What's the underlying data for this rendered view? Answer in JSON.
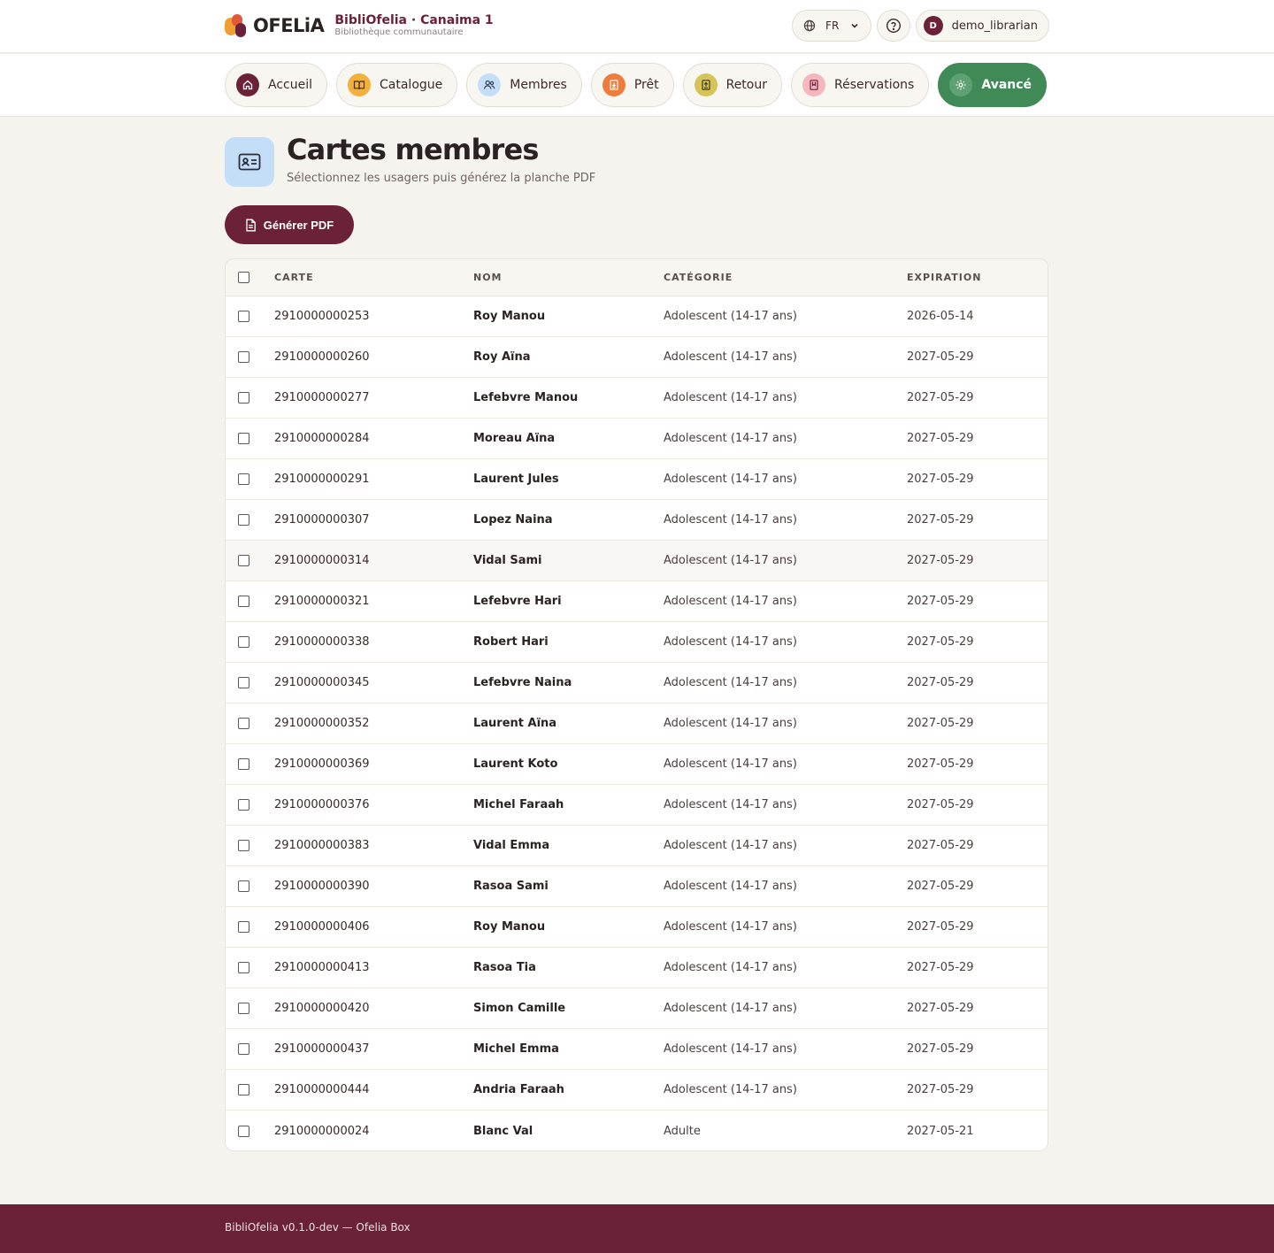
{
  "brand": {
    "logo_text": "OFELiA",
    "title": "BibliOfelia · Canaima 1",
    "subtitle": "Bibliothèque communautaire"
  },
  "header": {
    "language": "FR",
    "user_initial": "D",
    "username": "demo_librarian"
  },
  "nav": {
    "items": [
      {
        "label": "Accueil",
        "icon": "home-icon",
        "color": "#6b2238"
      },
      {
        "label": "Catalogue",
        "icon": "book-open-icon",
        "color": "#f2b13c"
      },
      {
        "label": "Membres",
        "icon": "users-icon",
        "color": "#c5def8"
      },
      {
        "label": "Prêt",
        "icon": "checkout-icon",
        "color": "#ee7d3b"
      },
      {
        "label": "Retour",
        "icon": "return-icon",
        "color": "#d6c35a"
      },
      {
        "label": "Réservations",
        "icon": "bookmark-icon",
        "color": "#f6b6bd"
      },
      {
        "label": "Avancé",
        "icon": "gear-icon",
        "color": "#3f8a57"
      }
    ]
  },
  "page": {
    "title": "Cartes membres",
    "subtitle": "Sélectionnez les usagers puis générez la planche PDF",
    "generate_button": "Générer PDF"
  },
  "table": {
    "columns": [
      "CARTE",
      "NOM",
      "CATÉGORIE",
      "EXPIRATION"
    ],
    "rows": [
      {
        "carte": "2910000000253",
        "nom": "Roy Manou",
        "categorie": "Adolescent (14-17 ans)",
        "expiration": "2026-05-14"
      },
      {
        "carte": "2910000000260",
        "nom": "Roy Aïna",
        "categorie": "Adolescent (14-17 ans)",
        "expiration": "2027-05-29"
      },
      {
        "carte": "2910000000277",
        "nom": "Lefebvre Manou",
        "categorie": "Adolescent (14-17 ans)",
        "expiration": "2027-05-29"
      },
      {
        "carte": "2910000000284",
        "nom": "Moreau Aïna",
        "categorie": "Adolescent (14-17 ans)",
        "expiration": "2027-05-29"
      },
      {
        "carte": "2910000000291",
        "nom": "Laurent Jules",
        "categorie": "Adolescent (14-17 ans)",
        "expiration": "2027-05-29"
      },
      {
        "carte": "2910000000307",
        "nom": "Lopez Naina",
        "categorie": "Adolescent (14-17 ans)",
        "expiration": "2027-05-29"
      },
      {
        "carte": "2910000000314",
        "nom": "Vidal Sami",
        "categorie": "Adolescent (14-17 ans)",
        "expiration": "2027-05-29"
      },
      {
        "carte": "2910000000321",
        "nom": "Lefebvre Hari",
        "categorie": "Adolescent (14-17 ans)",
        "expiration": "2027-05-29"
      },
      {
        "carte": "2910000000338",
        "nom": "Robert Hari",
        "categorie": "Adolescent (14-17 ans)",
        "expiration": "2027-05-29"
      },
      {
        "carte": "2910000000345",
        "nom": "Lefebvre Naina",
        "categorie": "Adolescent (14-17 ans)",
        "expiration": "2027-05-29"
      },
      {
        "carte": "2910000000352",
        "nom": "Laurent Aïna",
        "categorie": "Adolescent (14-17 ans)",
        "expiration": "2027-05-29"
      },
      {
        "carte": "2910000000369",
        "nom": "Laurent Koto",
        "categorie": "Adolescent (14-17 ans)",
        "expiration": "2027-05-29"
      },
      {
        "carte": "2910000000376",
        "nom": "Michel Faraah",
        "categorie": "Adolescent (14-17 ans)",
        "expiration": "2027-05-29"
      },
      {
        "carte": "2910000000383",
        "nom": "Vidal Emma",
        "categorie": "Adolescent (14-17 ans)",
        "expiration": "2027-05-29"
      },
      {
        "carte": "2910000000390",
        "nom": "Rasoa Sami",
        "categorie": "Adolescent (14-17 ans)",
        "expiration": "2027-05-29"
      },
      {
        "carte": "2910000000406",
        "nom": "Roy Manou",
        "categorie": "Adolescent (14-17 ans)",
        "expiration": "2027-05-29"
      },
      {
        "carte": "2910000000413",
        "nom": "Rasoa Tia",
        "categorie": "Adolescent (14-17 ans)",
        "expiration": "2027-05-29"
      },
      {
        "carte": "2910000000420",
        "nom": "Simon Camille",
        "categorie": "Adolescent (14-17 ans)",
        "expiration": "2027-05-29"
      },
      {
        "carte": "2910000000437",
        "nom": "Michel Emma",
        "categorie": "Adolescent (14-17 ans)",
        "expiration": "2027-05-29"
      },
      {
        "carte": "2910000000444",
        "nom": "Andria Faraah",
        "categorie": "Adolescent (14-17 ans)",
        "expiration": "2027-05-29"
      },
      {
        "carte": "2910000000024",
        "nom": "Blanc Val",
        "categorie": "Adulte",
        "expiration": "2027-05-21"
      }
    ]
  },
  "footer": {
    "text": "BibliOfelia v0.1.0-dev — Ofelia Box"
  }
}
